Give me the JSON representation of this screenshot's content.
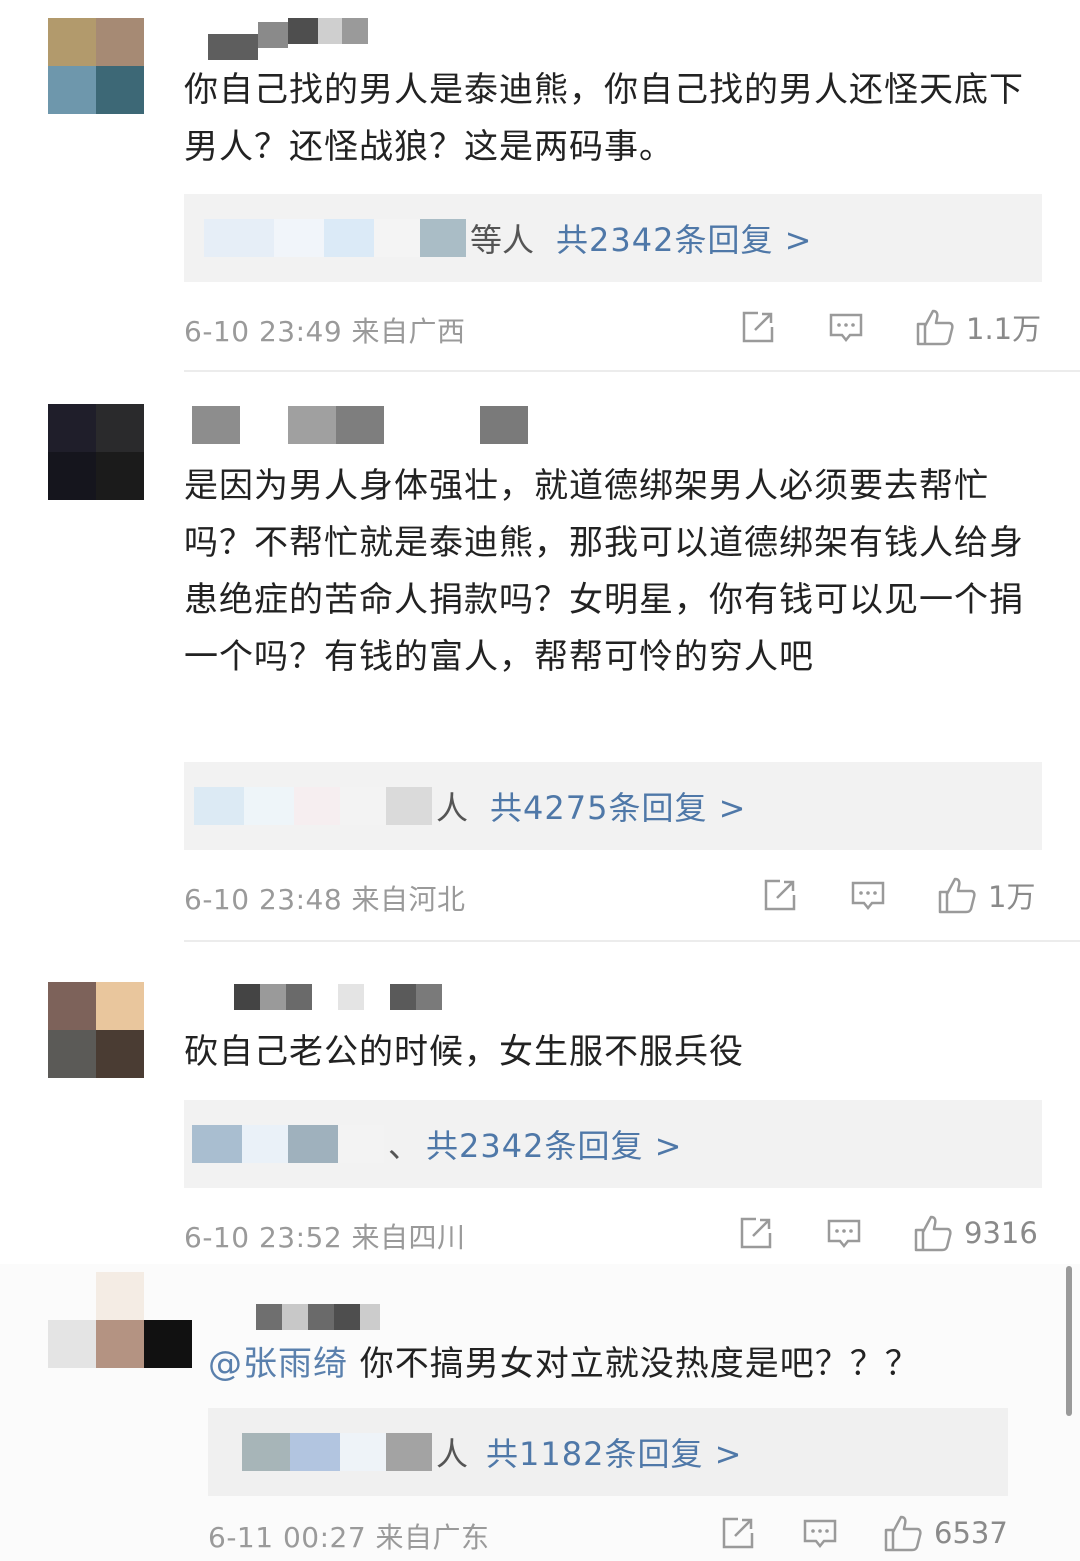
{
  "comments": [
    {
      "text": "你自己找的男人是泰迪熊，你自己找的男人还怪天底下男人？还怪战狼？这是两码事。",
      "reply_suffix": "等人",
      "reply_link": "共2342条回复 >",
      "meta": "6-10 23:49 来自广西",
      "likes": "1.1万",
      "avatar_colors": [
        "#b29a6c",
        "#a68a74",
        "#6e97ac",
        "#3d6876"
      ]
    },
    {
      "text": "是因为男人身体强壮，就道德绑架男人必须要去帮忙吗？不帮忙就是泰迪熊，那我可以道德绑架有钱人给身患绝症的苦命人捐款吗？女明星，你有钱可以见一个捐一个吗？有钱的富人，帮帮可怜的穷人吧",
      "reply_suffix": "人",
      "reply_link": "共4275条回复 >",
      "meta": "6-10 23:48 来自河北",
      "likes": "1万",
      "avatar_colors": [
        "#1f1e2a",
        "#2a2a2c",
        "#15151d",
        "#1b1b1b"
      ]
    },
    {
      "text": "砍自己老公的时候，女生服不服兵役",
      "reply_suffix": "、",
      "reply_link": "共2342条回复 >",
      "meta": "6-10 23:52 来自四川",
      "likes": "9316",
      "avatar_colors": [
        "#7d625a",
        "#e9c69d",
        "#5b5a57",
        "#4a3c33"
      ]
    },
    {
      "mention": "@张雨绮",
      "text": " 你不搞男女对立就没热度是吧？？？",
      "reply_suffix": "人",
      "reply_link": "共1182条回复 >",
      "meta": "6-11 00:27 来自广东",
      "likes": "6537",
      "avatar_colors": [
        "#f4ece4",
        "#e4e4e4",
        "#b49382",
        "#111111"
      ]
    }
  ]
}
